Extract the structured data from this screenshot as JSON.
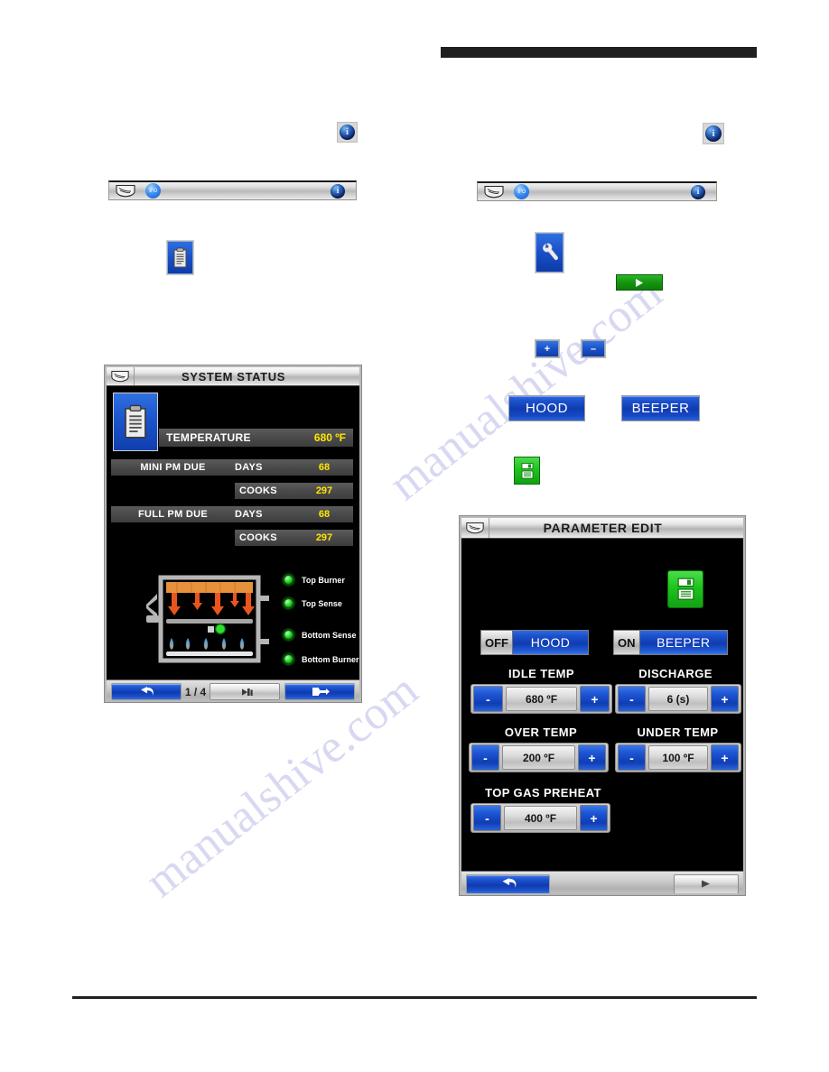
{
  "page": {
    "watermark_text_1": "manualshive.com",
    "watermark_text_2": "manualshive.com"
  },
  "left_column": {
    "info_icon_name": "info-icon",
    "toolbar": {
      "logo_name": "vulcan-shield-logo",
      "ifo_icon_name": "ifo-icon",
      "info_icon_name": "info-icon"
    },
    "clipboard_icon_name": "clipboard-icon"
  },
  "right_column": {
    "info_icon_name": "info-icon",
    "toolbar": {
      "logo_name": "vulcan-shield-logo",
      "ifo_icon_name": "ifo-icon",
      "info_icon_name": "info-icon"
    },
    "wrench_icon_name": "wrench-icon",
    "green_play_name": "green-play-button",
    "plus_label": "+",
    "minus_label": "–",
    "hood_button_label": "HOOD",
    "beeper_button_label": "BEEPER",
    "save_icon_name": "save-floppy-icon"
  },
  "system_status_screen": {
    "title": "SYSTEM STATUS",
    "rows": [
      {
        "label": "TEMPERATURE",
        "unit": "",
        "value": "680 ºF"
      },
      {
        "label": "MINI PM DUE",
        "unit": "DAYS",
        "value": "68"
      },
      {
        "label": "",
        "unit": "COOKS",
        "value": "297"
      },
      {
        "label": "FULL PM DUE",
        "unit": "DAYS",
        "value": "68"
      },
      {
        "label": "",
        "unit": "COOKS",
        "value": "297"
      }
    ],
    "status_leds": [
      {
        "label": "Top Burner",
        "color": "#2ee02e"
      },
      {
        "label": "Top Sense",
        "color": "#2ee02e"
      },
      {
        "label": "Bottom Sense",
        "color": "#2ee02e"
      },
      {
        "label": "Bottom Burner",
        "color": "#2ee02e"
      }
    ],
    "nav": {
      "back_icon": "back-arrow-icon",
      "page_indicator": "1 / 4",
      "prev_icon": "prev-page-icon",
      "next_icon": "next-page-icon"
    }
  },
  "parameter_edit_screen": {
    "title": "PARAMETER EDIT",
    "save_icon_name": "save-floppy-icon",
    "toggles": [
      {
        "state": "OFF",
        "name": "HOOD"
      },
      {
        "state": "ON",
        "name": "BEEPER"
      }
    ],
    "parameters": [
      {
        "label": "IDLE TEMP",
        "value": "680 ºF",
        "minus": "-",
        "plus": "+"
      },
      {
        "label": "DISCHARGE",
        "value": "6 (s)",
        "minus": "-",
        "plus": "+"
      },
      {
        "label": "OVER TEMP",
        "value": "200 ºF",
        "minus": "-",
        "plus": "+"
      },
      {
        "label": "UNDER TEMP",
        "value": "100 ºF",
        "minus": "-",
        "plus": "+"
      },
      {
        "label": "TOP GAS PREHEAT",
        "value": "400 ºF",
        "minus": "-",
        "plus": "+"
      }
    ],
    "nav": {
      "back_icon": "back-arrow-icon",
      "next_icon": "next-arrow-icon"
    }
  },
  "colors": {
    "accent_blue": "#1a50c6",
    "value_yellow": "#ffe600",
    "led_green": "#2ee02e",
    "panel_black": "#000000",
    "row_grey": "#4a4a4a"
  }
}
